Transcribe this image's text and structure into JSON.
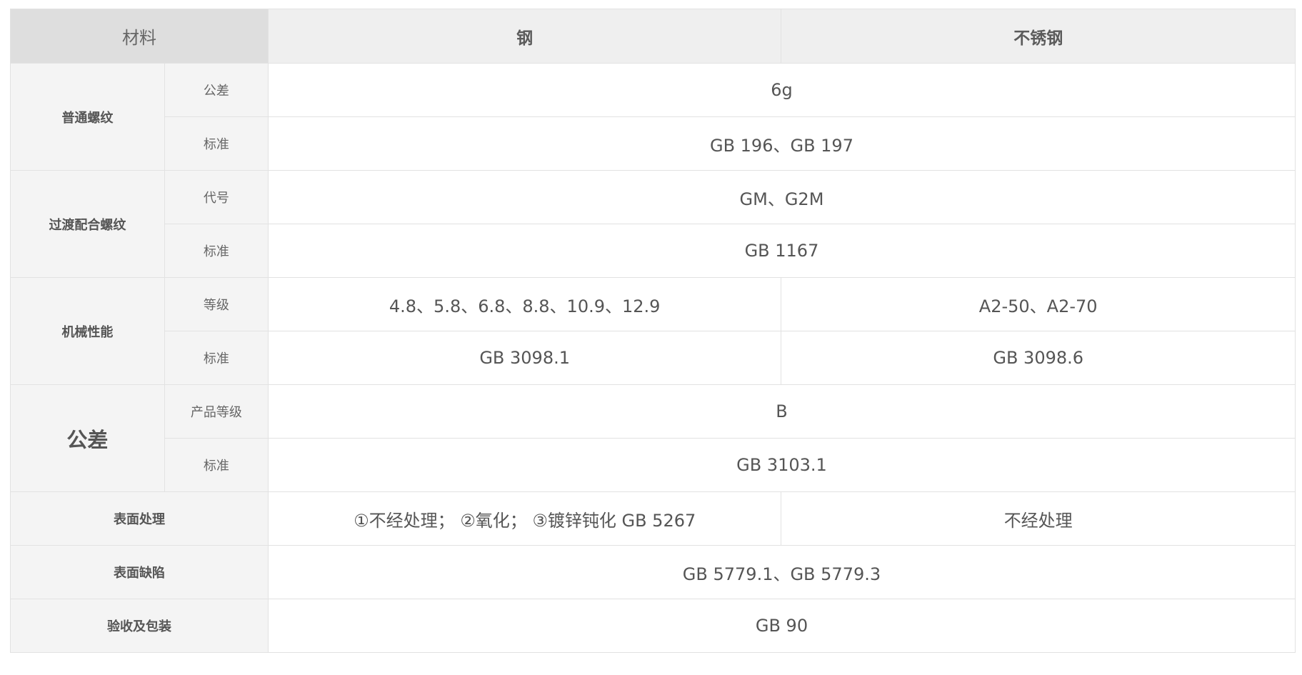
{
  "header": {
    "material": "材料",
    "steel": "钢",
    "stainless": "不锈钢"
  },
  "rows": {
    "thread_normal": {
      "group": "普通螺纹",
      "tolerance_label": "公差",
      "tolerance_value": "6g",
      "standard_label": "标准",
      "standard_value": "GB 196、GB 197"
    },
    "thread_transition": {
      "group": "过渡配合螺纹",
      "code_label": "代号",
      "code_value": "GM、G2M",
      "standard_label": "标准",
      "standard_value": "GB 1167"
    },
    "mechanical": {
      "group": "机械性能",
      "grade_label": "等级",
      "grade_steel": "4.8、5.8、6.8、8.8、10.9、12.9",
      "grade_stainless": "A2-50、A2-70",
      "standard_label": "标准",
      "standard_steel": "GB 3098.1",
      "standard_stainless": "GB 3098.6"
    },
    "tolerance": {
      "group": "公差",
      "product_grade_label": "产品等级",
      "product_grade_value": "B",
      "standard_label": "标准",
      "standard_value": "GB 3103.1"
    },
    "surface_treatment": {
      "group": "表面处理",
      "steel": "①不经处理； ②氧化； ③镀锌钝化 GB 5267",
      "stainless": "不经处理"
    },
    "surface_defects": {
      "group": "表面缺陷",
      "value": "GB 5779.1、GB 5779.3"
    },
    "acceptance": {
      "group": "验收及包装",
      "value": "GB 90"
    }
  }
}
